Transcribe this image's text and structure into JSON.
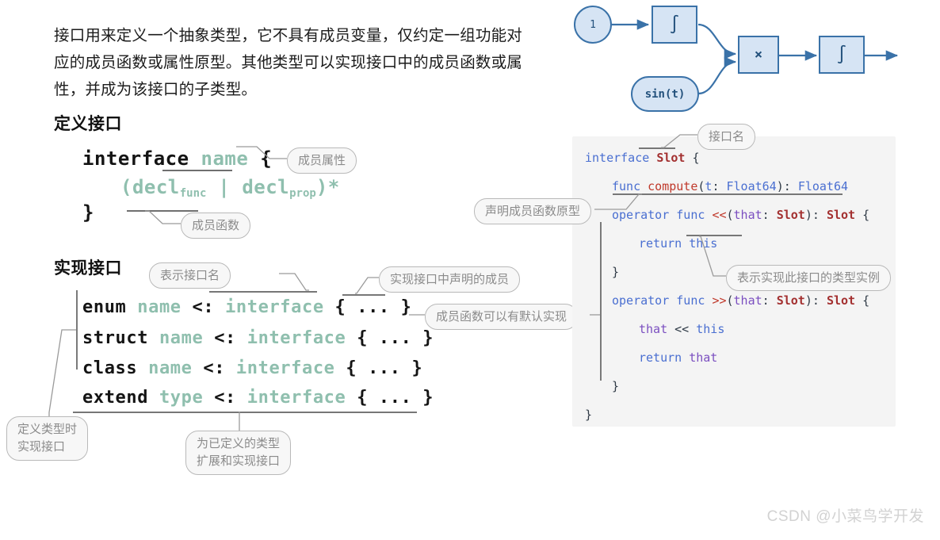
{
  "intro": {
    "paragraph": "接口用来定义一个抽象类型，它不具有成员变量，仅约定一组功能对应的成员函数或属性原型。其他类型可以实现接口中的成员函数或属性，并成为该接口的子类型。"
  },
  "sections": {
    "define_title": "定义接口",
    "implement_title": "实现接口"
  },
  "define_syntax": {
    "line1_kw": "interface",
    "line1_name": "name",
    "line1_brace": "{",
    "line2_open": "(",
    "line2_decl1": "decl",
    "line2_sub1": "func",
    "line2_pipe": " | ",
    "line2_decl2": "decl",
    "line2_sub2": "prop",
    "line2_close": ")*",
    "line3_brace": "}"
  },
  "implement_syntax": {
    "rows": [
      {
        "kw": "enum",
        "name": "name",
        "op": "<:",
        "iface": "interface",
        "body": "{ ... }"
      },
      {
        "kw": "struct",
        "name": "name",
        "op": "<:",
        "iface": "interface",
        "body": "{ ... }"
      },
      {
        "kw": "class",
        "name": "name",
        "op": "<:",
        "iface": "interface",
        "body": "{ ... }"
      },
      {
        "kw": "extend",
        "name": "type",
        "op": "<:",
        "iface": "interface",
        "body": "{ ... }"
      }
    ]
  },
  "callouts": {
    "member_property": "成员属性",
    "member_function": "成员函数",
    "shows_interface_name": "表示接口名",
    "implements_declared_members": "实现接口中声明的成员",
    "member_func_default_impl": "成员函数可以有默认实现",
    "define_type_implement": "定义类型时\n实现接口",
    "extend_existing_type": "为已定义的类型\n扩展和实现接口",
    "interface_name": "接口名",
    "declare_member_prototype": "声明成员函数原型",
    "instance_of_implementing_type": "表示实现此接口的类型实例"
  },
  "code_panel": {
    "lines": [
      {
        "indent": 0,
        "tokens": [
          {
            "t": "interface ",
            "c": "kw"
          },
          {
            "t": "Slot",
            "c": "ty"
          },
          {
            "t": " {",
            "c": "pl"
          }
        ]
      },
      {
        "indent": 1,
        "tokens": [
          {
            "t": "func ",
            "c": "kw"
          },
          {
            "t": "compute",
            "c": "fn"
          },
          {
            "t": "(",
            "c": "pl"
          },
          {
            "t": "t",
            "c": "bl"
          },
          {
            "t": ": ",
            "c": "pl"
          },
          {
            "t": "Float64",
            "c": "bl"
          },
          {
            "t": "): ",
            "c": "pl"
          },
          {
            "t": "Float64",
            "c": "bl"
          }
        ]
      },
      {
        "indent": 1,
        "tokens": [
          {
            "t": "operator func ",
            "c": "kw"
          },
          {
            "t": "<<",
            "c": "fn"
          },
          {
            "t": "(",
            "c": "pl"
          },
          {
            "t": "that",
            "c": "pm"
          },
          {
            "t": ": ",
            "c": "pl"
          },
          {
            "t": "Slot",
            "c": "ty"
          },
          {
            "t": "): ",
            "c": "pl"
          },
          {
            "t": "Slot",
            "c": "ty"
          },
          {
            "t": " {",
            "c": "pl"
          }
        ]
      },
      {
        "indent": 2,
        "tokens": [
          {
            "t": "return ",
            "c": "kw"
          },
          {
            "t": "this",
            "c": "kw"
          }
        ]
      },
      {
        "indent": 1,
        "tokens": [
          {
            "t": "}",
            "c": "pl"
          }
        ]
      },
      {
        "indent": 1,
        "tokens": [
          {
            "t": "operator func ",
            "c": "kw"
          },
          {
            "t": ">>",
            "c": "fn"
          },
          {
            "t": "(",
            "c": "pl"
          },
          {
            "t": "that",
            "c": "pm"
          },
          {
            "t": ": ",
            "c": "pl"
          },
          {
            "t": "Slot",
            "c": "ty"
          },
          {
            "t": "): ",
            "c": "pl"
          },
          {
            "t": "Slot",
            "c": "ty"
          },
          {
            "t": " {",
            "c": "pl"
          }
        ]
      },
      {
        "indent": 2,
        "tokens": [
          {
            "t": "that",
            "c": "pm"
          },
          {
            "t": " << ",
            "c": "pl"
          },
          {
            "t": "this",
            "c": "kw"
          }
        ]
      },
      {
        "indent": 2,
        "tokens": [
          {
            "t": "return ",
            "c": "kw"
          },
          {
            "t": "that",
            "c": "pm"
          }
        ]
      },
      {
        "indent": 1,
        "tokens": [
          {
            "t": "}",
            "c": "pl"
          }
        ]
      },
      {
        "indent": 0,
        "tokens": [
          {
            "t": "}",
            "c": "pl"
          }
        ]
      }
    ]
  },
  "diagram": {
    "nodes": [
      {
        "name": "const-one-node",
        "label": "1",
        "shape": "circle"
      },
      {
        "name": "integrator-1-node",
        "label": "∫",
        "shape": "rect"
      },
      {
        "name": "multiply-node",
        "label": "×",
        "shape": "rect"
      },
      {
        "name": "integrator-2-node",
        "label": "∫",
        "shape": "rect"
      },
      {
        "name": "sine-source-node",
        "label": "sin(t)",
        "shape": "pill"
      }
    ],
    "fill": "#d6e4f4",
    "stroke": "#3a72a8"
  },
  "watermark": {
    "text": "CSDN @小菜鸟学开发"
  },
  "colors": {
    "accent_green": "#8fbfae",
    "code_keyword_blue": "#4a6fd1",
    "code_type_red": "#a33030",
    "code_param_purple": "#7b4fc0",
    "panel_bg": "#f4f4f4",
    "bubble_bg": "#f7f7f7",
    "bubble_border": "#b9b9b9",
    "bubble_text": "#8b8b8b"
  }
}
